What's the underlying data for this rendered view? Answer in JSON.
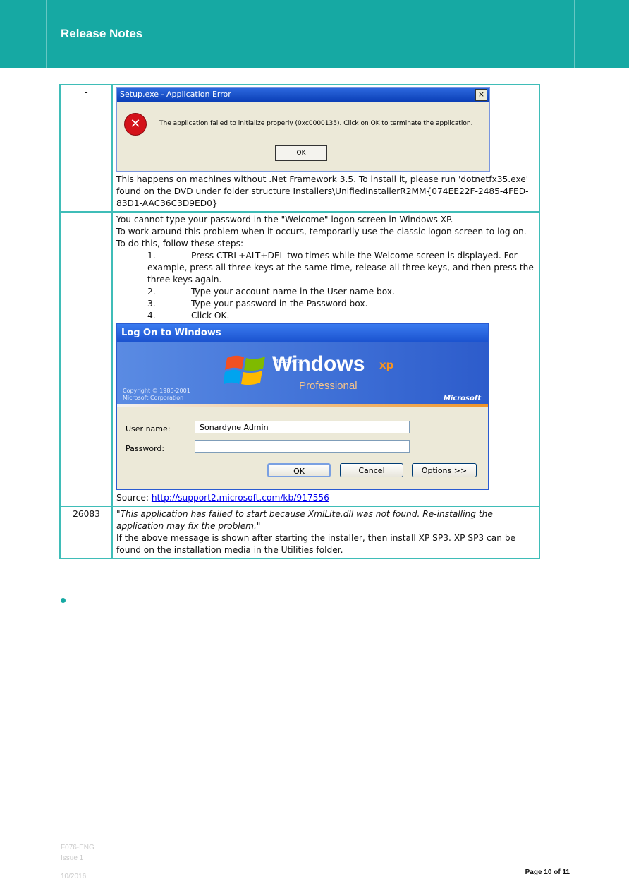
{
  "header": {
    "title": "Release Notes",
    "color": "#16a9a3"
  },
  "rows": [
    {
      "id": "-",
      "dialog": {
        "title": "Setup.exe - Application Error",
        "close": "×",
        "message": "The application failed to initialize properly (0xc0000135). Click on OK to terminate the application.",
        "ok": "OK"
      },
      "text": "This happens on machines without .Net Framework 3.5. To install it, please run 'dotnetfx35.exe' found on the DVD under folder structure Installers\\UnifiedInstallerR2MM{074EE22F-2485-4FED-83D1-AAC36C3D9ED0}"
    },
    {
      "id": "-",
      "intro1": "You cannot type your password in the \"Welcome\" logon screen in Windows XP.",
      "intro2": "To work around this problem when it occurs, temporarily use the classic logon screen to log on. To do this, follow these steps:",
      "steps": [
        {
          "num": "1.",
          "text": "Press CTRL+ALT+DEL two times while the Welcome screen is displayed. For example, press all three keys at the same time, release all three keys, and then press the three keys again."
        },
        {
          "num": "2.",
          "text": "Type your account name in the User name box."
        },
        {
          "num": "3.",
          "text": "Type your password in the Password box."
        },
        {
          "num": "4.",
          "text": "Click OK."
        }
      ],
      "logon": {
        "title": "Log On to Windows",
        "microsoft_small": "Microsoft",
        "windows": "Windows",
        "xp": "xp",
        "professional": "Professional",
        "copyright1": "Copyright © 1985-2001",
        "copyright2": "Microsoft Corporation",
        "microsoft_logo": "Microsoft",
        "username_label": "User name:",
        "username_value": "Sonardyne Admin",
        "password_label": "Password:",
        "ok": "OK",
        "cancel": "Cancel",
        "options": "Options >>"
      },
      "source_label": "Source: ",
      "source_link": "http://support2.microsoft.com/kb/917556"
    },
    {
      "id": "26083",
      "error_quote": "\"This application has failed to start because XmlLite.dll was not found. Re-installing the application may fix the problem.\"",
      "text": "If the above message is shown after starting the installer, then install XP SP3. XP SP3 can be found on the installation media in the Utilities folder."
    }
  ],
  "footer": {
    "form": "F076-ENG",
    "issue": "Issue 1",
    "date": "10/2016",
    "page": "Page 10 of 11"
  }
}
